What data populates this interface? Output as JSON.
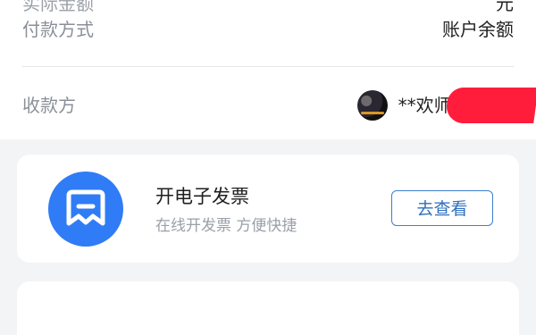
{
  "payment": {
    "cut_label": "实际金额",
    "cut_value": "元",
    "method_label": "付款方式",
    "method_value": "账户余额",
    "payee_label": "收款方",
    "payee_value": "**欢师傅 浙FF"
  },
  "invoice": {
    "title": "开电子发票",
    "subtitle": "在线开发票 方便快捷",
    "button_label": "去查看"
  },
  "colors": {
    "accent": "#2f7cf6",
    "button_border": "#3d7fd0",
    "redaction": "#ff1d3b",
    "background": "#f3f4f6"
  },
  "icons": {
    "invoice": "receipt-icon",
    "payee_avatar": "avatar"
  }
}
